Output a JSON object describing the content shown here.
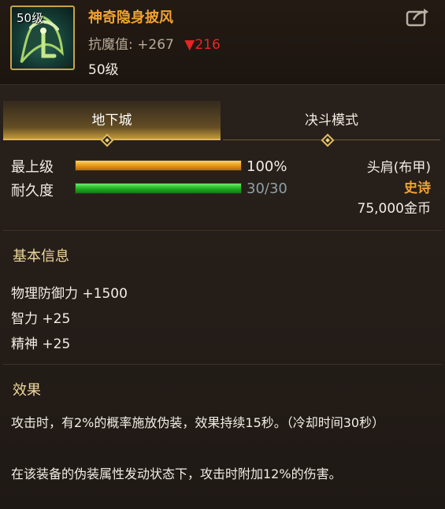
{
  "item": {
    "icon_level": "50级",
    "name": "神奇隐身披风",
    "stat_label": "抗魔值:",
    "stat_value": "+267",
    "stat_change": "▼216",
    "level": "50级",
    "icon": "cloak-item-icon"
  },
  "header": {
    "share_icon": "share-icon"
  },
  "tabs": [
    {
      "label": "地下城",
      "active": true
    },
    {
      "label": "决斗模式",
      "active": false
    }
  ],
  "bars": {
    "upgrade_label": "最上级",
    "upgrade_value": "100%",
    "upgrade_fraction": 1.0,
    "durability_label": "耐久度",
    "durability_value": "30/30",
    "durability_fraction": 1.0
  },
  "info": {
    "slot": "头肩(布甲)",
    "rarity": "史诗",
    "price": "75,000金币"
  },
  "basic": {
    "title": "基本信息",
    "stats": [
      "物理防御力 +1500",
      "智力 +25",
      "精神 +25"
    ]
  },
  "effect": {
    "title": "效果",
    "lines": [
      "攻击时，有2%的概率施放伪装，效果持续15秒。（冷却时间30秒）",
      "在该装备的伪装属性发动状态下，攻击时附加12%的伤害。"
    ]
  },
  "colors": {
    "rarity": "#f0a332",
    "stat_down": "#e82424",
    "accent_gold": "#e0b84a"
  }
}
